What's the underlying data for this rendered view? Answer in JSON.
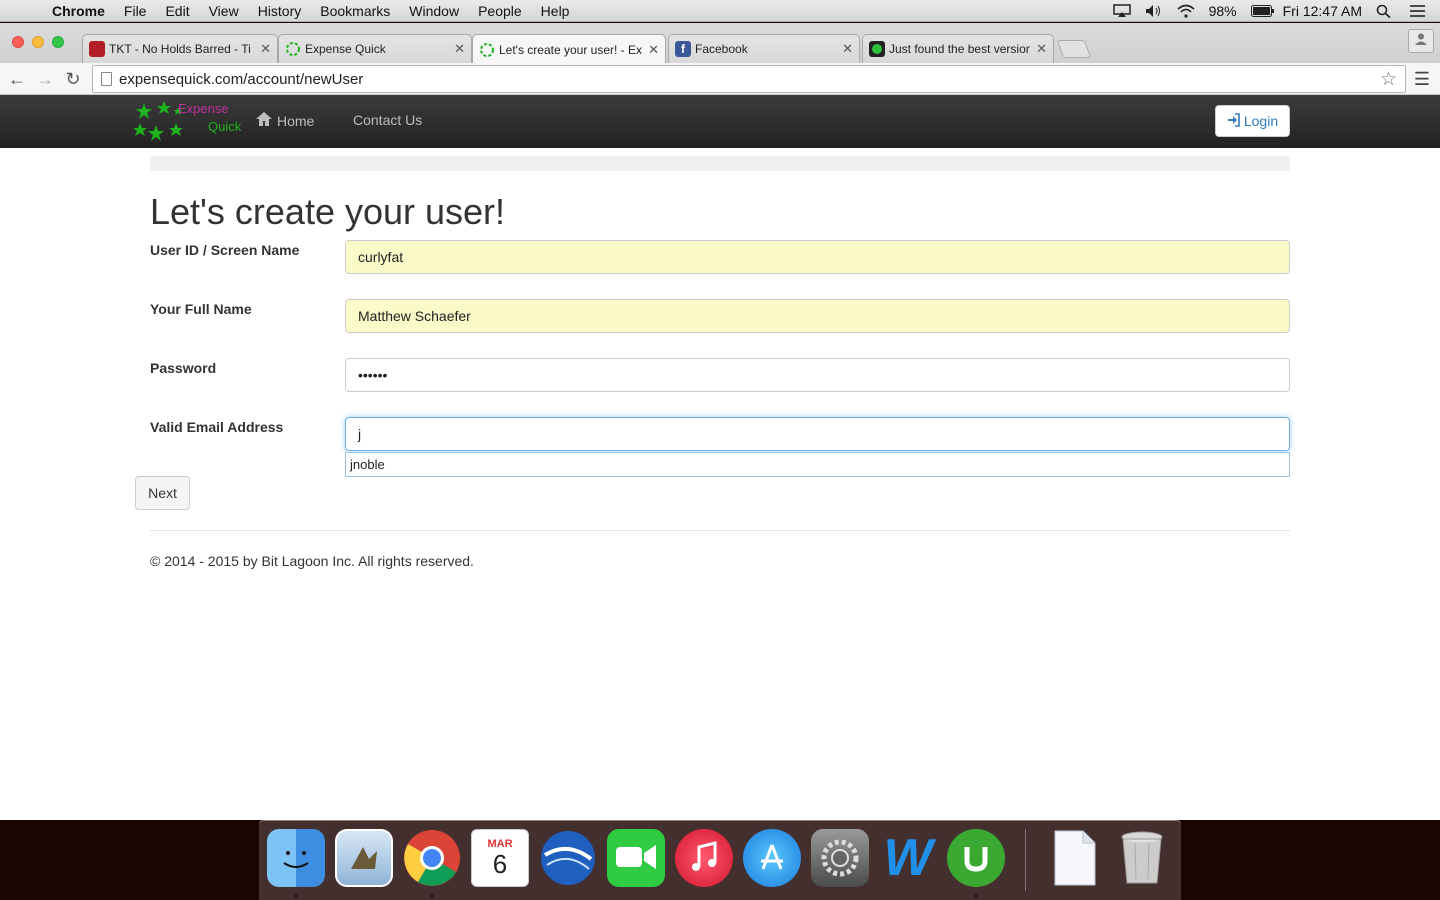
{
  "menubar": {
    "app": "Chrome",
    "items": [
      "File",
      "Edit",
      "View",
      "History",
      "Bookmarks",
      "Window",
      "People",
      "Help"
    ],
    "battery": "98%",
    "clock": "Fri 12:47 AM"
  },
  "tabs": [
    {
      "label": "TKT - No Holds Barred - Ti",
      "icon": "tkt-favicon",
      "active": false
    },
    {
      "label": "Expense Quick",
      "icon": "expensequick-favicon",
      "active": false
    },
    {
      "label": "Let's create your user! - Ex",
      "icon": "expensequick-favicon",
      "active": true
    },
    {
      "label": "Facebook",
      "icon": "facebook-favicon",
      "active": false
    },
    {
      "label": "Just found the best version",
      "icon": "green-favicon",
      "active": false
    }
  ],
  "toolbar": {
    "url": "expensequick.com/account/newUser"
  },
  "site_nav": {
    "logo_line1": "Expense",
    "logo_line2": "Quick",
    "home": "Home",
    "contact": "Contact Us",
    "login": "Login"
  },
  "form": {
    "heading": "Let's create your user!",
    "fields": [
      {
        "label": "User ID / Screen Name",
        "value": "curlyfat",
        "autofilled": true
      },
      {
        "label": "Your Full Name",
        "value": "Matthew Schaefer",
        "autofilled": true
      },
      {
        "label": "Password",
        "value": "••••••",
        "autofilled": false
      },
      {
        "label": "Valid Email Address",
        "value": "j",
        "autofilled": false,
        "focused": true
      }
    ],
    "autocomplete_suggestion": "jnoble",
    "next_button": "Next"
  },
  "footer": {
    "text": "© 2014 - 2015 by Bit Lagoon Inc. All rights reserved."
  },
  "dock": {
    "calendar_month": "MAR",
    "calendar_day": "6",
    "items": [
      "finder-icon",
      "mail-icon",
      "chrome-icon",
      "calendar-icon",
      "google-earth-icon",
      "facetime-icon",
      "itunes-icon",
      "app-store-icon",
      "system-preferences-icon",
      "word-icon",
      "utorrent-icon",
      "document-icon",
      "trash-icon"
    ]
  },
  "colors": {
    "autofill_bg": "#fafbc8",
    "link_blue": "#337ab7",
    "logo_green": "#1db31d",
    "logo_magenta": "#c0309a"
  }
}
